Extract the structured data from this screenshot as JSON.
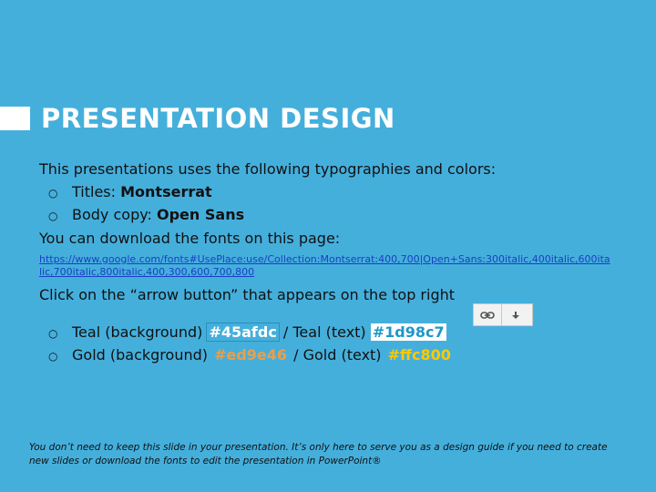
{
  "slide": {
    "title": "PRESENTATION DESIGN",
    "intro": "This presentations uses the following typographies and colors:",
    "typography": [
      {
        "label": "Titles: ",
        "value": "Montserrat"
      },
      {
        "label": "Body copy: ",
        "value": "Open Sans"
      }
    ],
    "download_text": "You can download the fonts on this page:",
    "font_link_line1": "https://www.google.com/fonts#UsePlace:use/Collection:Montserrat:400,700|Open+Sans:300italic,400italic,600ita",
    "font_link_line2": "lic,700italic,800italic,400,300,600,700,800",
    "arrow_instruction": "Click on the “arrow button” that appears on the top right",
    "colors": {
      "teal_bg_label": "Teal (background) ",
      "teal_bg_value": "#45afdc",
      "teal_separator": " / Teal (text) ",
      "teal_text_value": "#1d98c7",
      "gold_bg_label": "Gold (background) ",
      "gold_bg_value": "#ed9e46",
      "gold_separator": " / Gold (text) ",
      "gold_text_value": "#ffc800"
    },
    "footer": "You don’t need to keep this slide in your presentation. It’s only here to serve you as a design guide if you need to create new slides or download the fonts to edit the presentation in PowerPoint®"
  },
  "toolbar": {
    "buttons": [
      {
        "icon": "link-icon"
      },
      {
        "icon": "download-arrow-icon"
      }
    ]
  },
  "theme": {
    "background": "#45afdc",
    "title_color": "#ffffff",
    "teal_text": "#1d98c7",
    "gold_bg": "#ed9e46",
    "gold_text": "#ffc800"
  }
}
